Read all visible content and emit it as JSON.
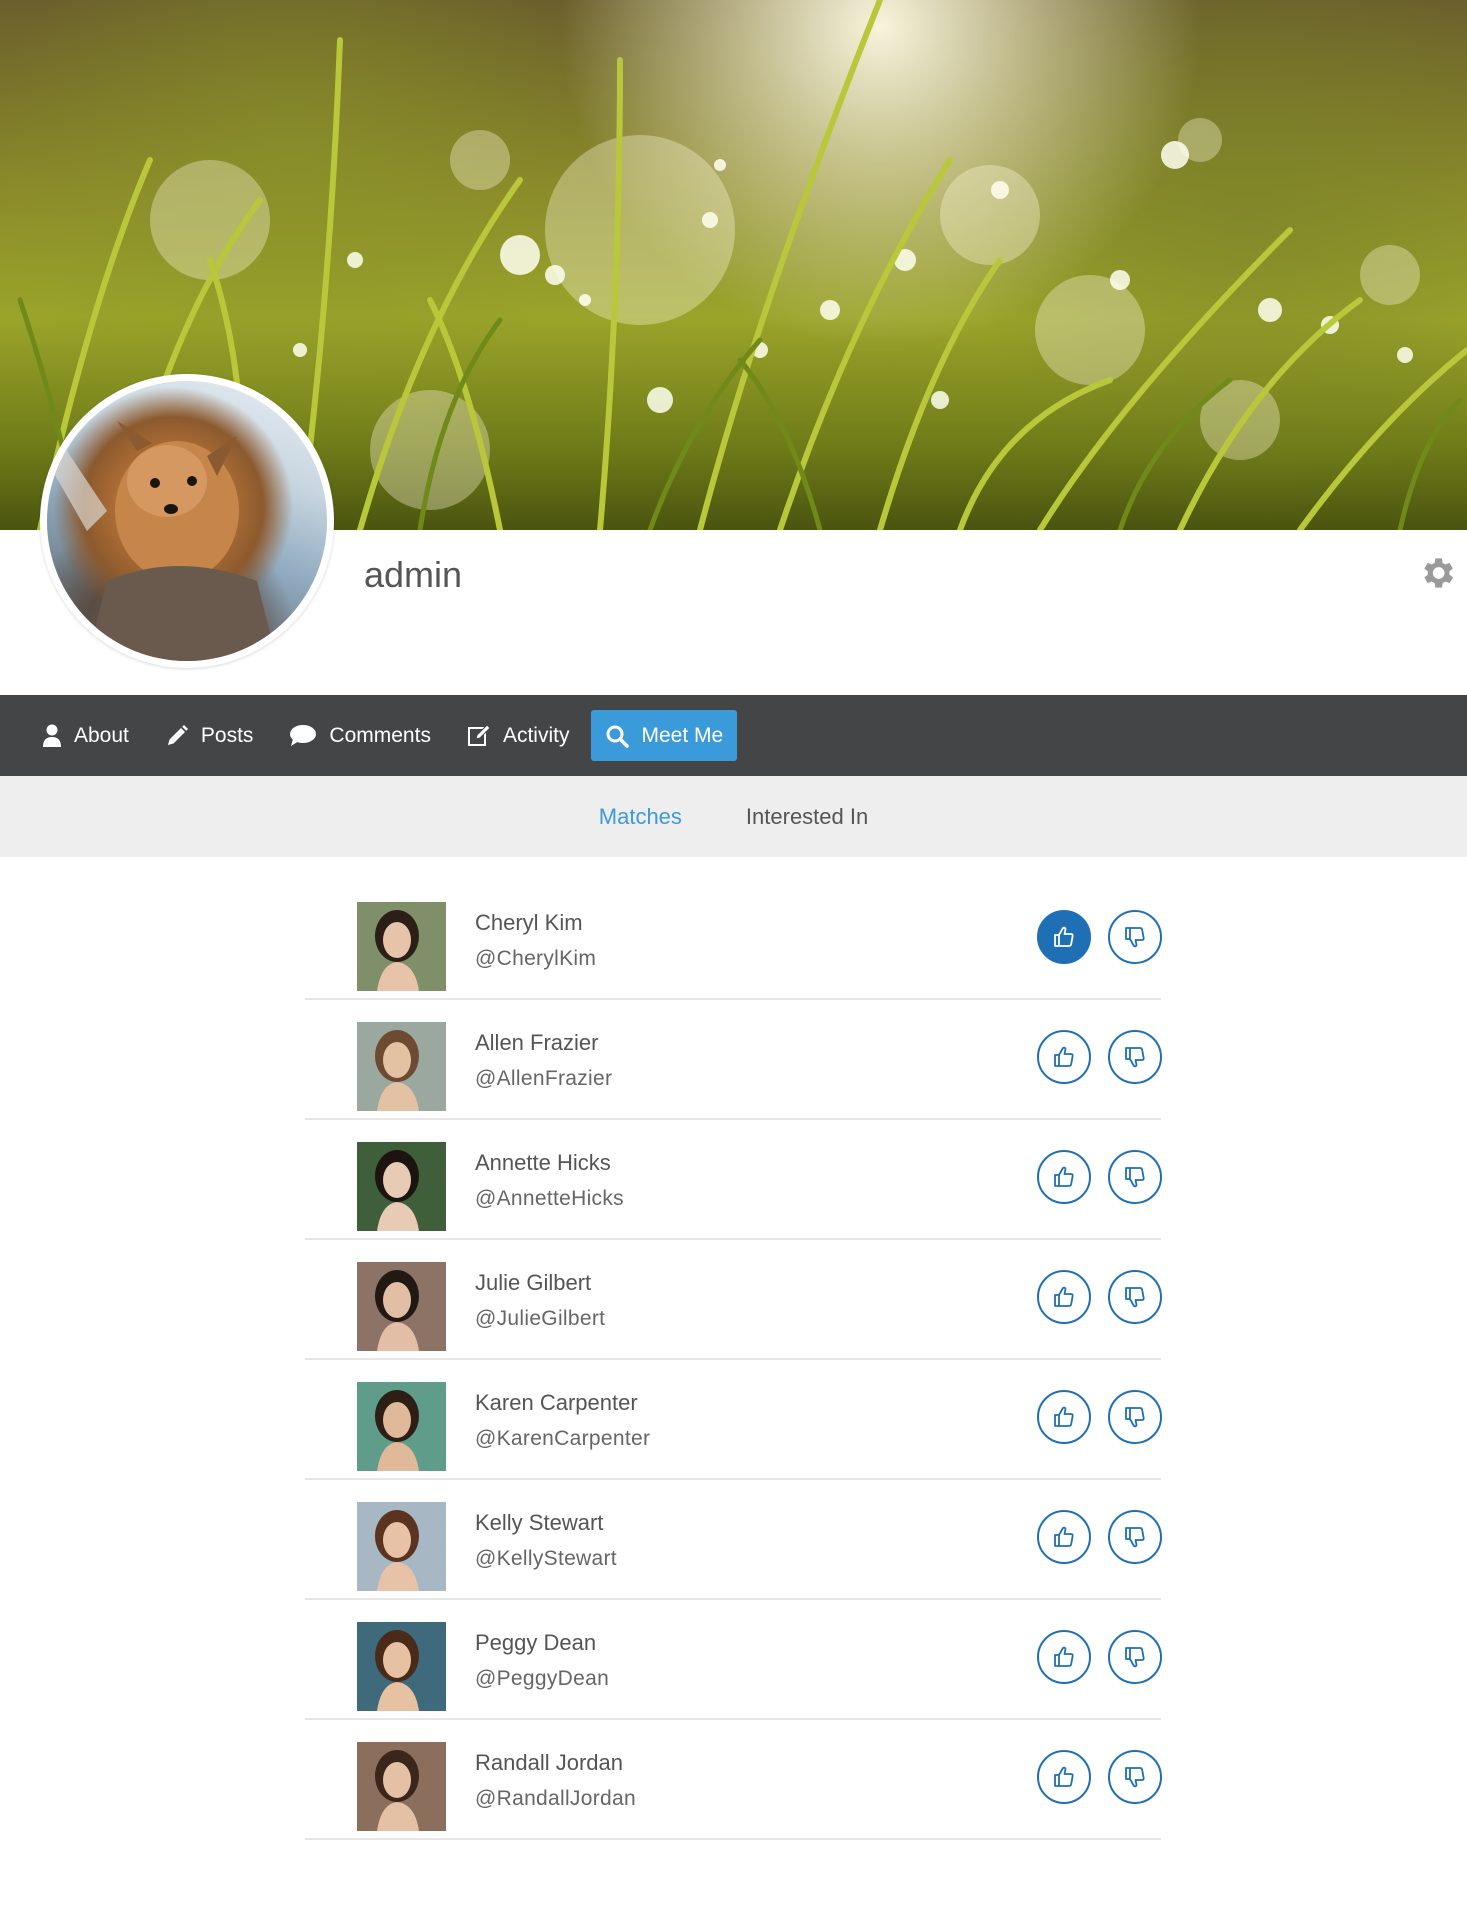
{
  "profile": {
    "name": "admin"
  },
  "nav": {
    "items": [
      {
        "label": "About",
        "icon": "user-icon",
        "active": false
      },
      {
        "label": "Posts",
        "icon": "pencil-icon",
        "active": false
      },
      {
        "label": "Comments",
        "icon": "comment-icon",
        "active": false
      },
      {
        "label": "Activity",
        "icon": "edit-icon",
        "active": false
      },
      {
        "label": "Meet Me",
        "icon": "search-icon",
        "active": true
      }
    ]
  },
  "subtabs": {
    "items": [
      {
        "label": "Matches",
        "active": true
      },
      {
        "label": "Interested In",
        "active": false
      }
    ]
  },
  "matches": [
    {
      "name": "Cheryl Kim",
      "handle": "@CherylKim",
      "liked": true,
      "photo_bg": "#7f8f6a",
      "photo_skin": "#e6c3a9",
      "photo_hair": "#2b1f18"
    },
    {
      "name": "Allen Frazier",
      "handle": "@AllenFrazier",
      "liked": false,
      "photo_bg": "#9aa8a0",
      "photo_skin": "#e3c1a3",
      "photo_hair": "#6d4a32"
    },
    {
      "name": "Annette Hicks",
      "handle": "@AnnetteHicks",
      "liked": false,
      "photo_bg": "#3f5e3a",
      "photo_skin": "#e8cbb5",
      "photo_hair": "#1c1410"
    },
    {
      "name": "Julie Gilbert",
      "handle": "@JulieGilbert",
      "liked": false,
      "photo_bg": "#8d7366",
      "photo_skin": "#e2bea6",
      "photo_hair": "#231914"
    },
    {
      "name": "Karen Carpenter",
      "handle": "@KarenCarpenter",
      "liked": false,
      "photo_bg": "#5f9c8a",
      "photo_skin": "#e0b89a",
      "photo_hair": "#2e1f16"
    },
    {
      "name": "Kelly Stewart",
      "handle": "@KellyStewart",
      "liked": false,
      "photo_bg": "#a7b7c4",
      "photo_skin": "#e7c2a6",
      "photo_hair": "#5a3420"
    },
    {
      "name": "Peggy Dean",
      "handle": "@PeggyDean",
      "liked": false,
      "photo_bg": "#3f6a7c",
      "photo_skin": "#e6c1a2",
      "photo_hair": "#4a2b1a"
    },
    {
      "name": "Randall Jordan",
      "handle": "@RandallJordan",
      "liked": false,
      "photo_bg": "#8c6e5c",
      "photo_skin": "#e4c0a4",
      "photo_hair": "#3a261a"
    }
  ],
  "colors": {
    "accent": "#3b9ad9",
    "button_blue": "#1f6fb5",
    "navbar": "#444546",
    "subtabs_bg": "#eeeeee"
  }
}
